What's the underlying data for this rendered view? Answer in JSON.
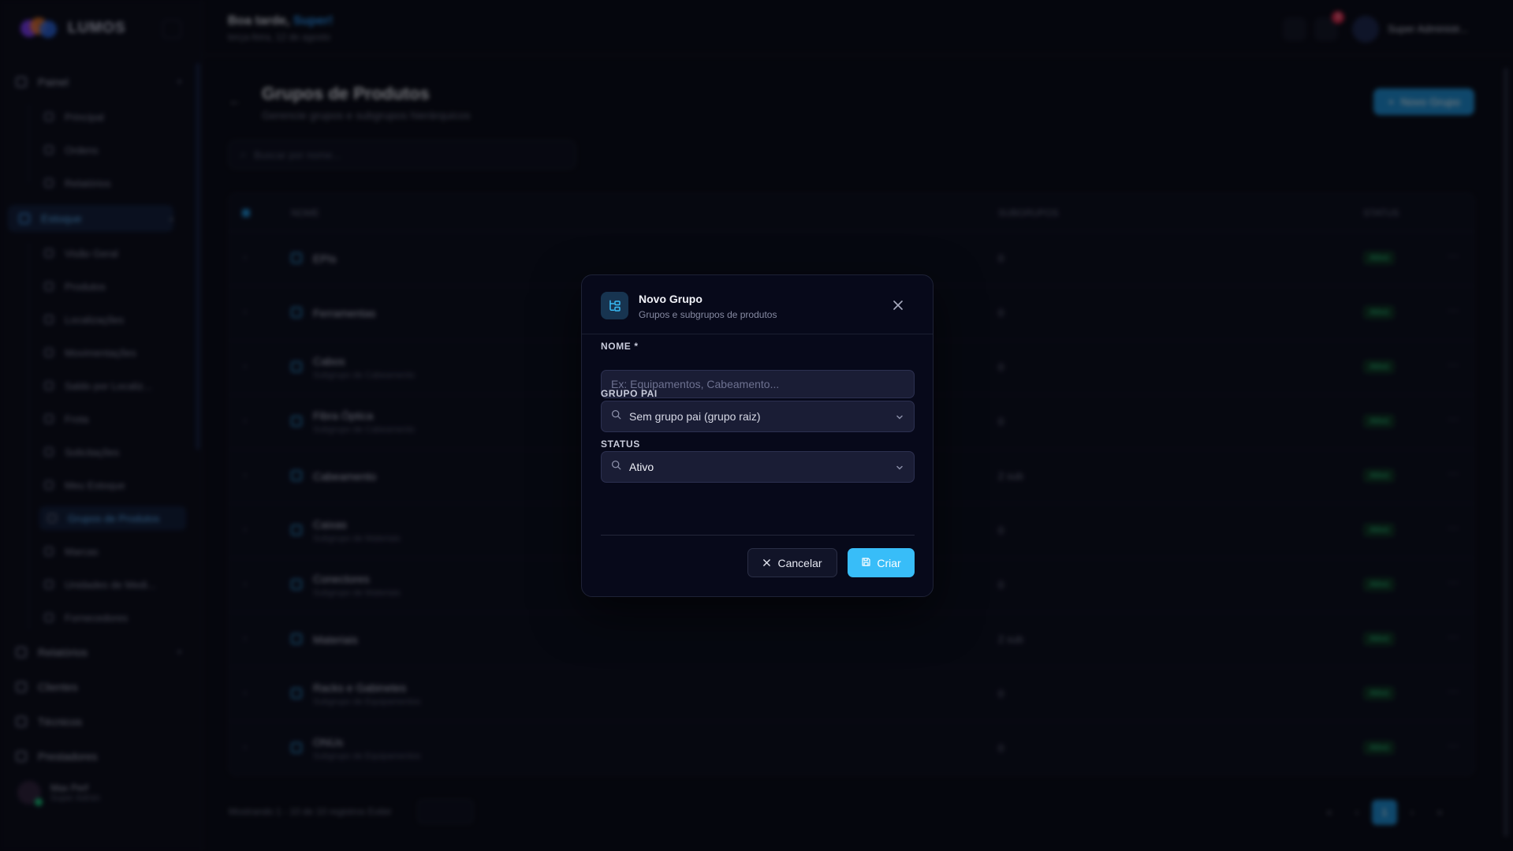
{
  "app": {
    "brand": "LUMOS",
    "greeting_prefix": "Boa tarde,",
    "greeting_name": "Super!",
    "date_line": "terça-feira, 12 de agosto",
    "notifications_count": "3",
    "user_name": "Super Administr..."
  },
  "sidebar": {
    "sections": [
      {
        "label": "Painel",
        "items": [
          "Principal",
          "Ordens",
          "Relatórios"
        ]
      },
      {
        "label": "Estoque",
        "items": [
          "Visão Geral",
          "Produtos",
          "Localizações",
          "Movimentações",
          "Saldo por Localiz...",
          "Frota",
          "Solicitações",
          "Meu Estoque",
          "Grupos de Produtos",
          "Marcas",
          "Unidades de Medi...",
          "Fornecedores"
        ]
      },
      {
        "label": "Relatórios"
      },
      {
        "label": "Clientes"
      },
      {
        "label": "Técnicos"
      },
      {
        "label": "Prestadores"
      }
    ],
    "user": {
      "name": "Max Perf",
      "role": "Super Admin"
    }
  },
  "page": {
    "title": "Grupos de Produtos",
    "subtitle": "Gerencie grupos e subgrupos hierárquicos",
    "new_button": "Novo Grupo",
    "search_placeholder": "Buscar por nome...",
    "columns": {
      "name": "NOME",
      "subgroups": "SUBGRUPOS",
      "status": "STATUS"
    },
    "rows": [
      {
        "name": "EPIs",
        "parent": "",
        "subgroups": "0",
        "status": "Ativo"
      },
      {
        "name": "Ferramentas",
        "parent": "",
        "subgroups": "0",
        "status": "Ativo"
      },
      {
        "name": "Cabos",
        "parent": "Subgrupo de Cabeamento",
        "subgroups": "0",
        "status": "Ativo"
      },
      {
        "name": "Fibra Óptica",
        "parent": "Subgrupo de Cabeamento",
        "subgroups": "0",
        "status": "Ativo"
      },
      {
        "name": "Cabeamento",
        "parent": "",
        "subgroups": "2 sub",
        "status": "Ativo"
      },
      {
        "name": "Caixas",
        "parent": "Subgrupo de Materiais",
        "subgroups": "0",
        "status": "Ativo"
      },
      {
        "name": "Conectores",
        "parent": "Subgrupo de Materiais",
        "subgroups": "0",
        "status": "Ativo"
      },
      {
        "name": "Materiais",
        "parent": "",
        "subgroups": "2 sub",
        "status": "Ativo"
      },
      {
        "name": "Racks e Gabinetes",
        "parent": "Subgrupo de Equipamentos",
        "subgroups": "0",
        "status": "Ativo"
      },
      {
        "name": "ONUs",
        "parent": "Subgrupo de Equipamentos",
        "subgroups": "0",
        "status": "Ativo"
      }
    ],
    "footer_info": "Mostrando 1 - 10 de 10 registros  Exibir",
    "current_page": "1"
  },
  "modal": {
    "title": "Novo Grupo",
    "subtitle": "Grupos e subgrupos de produtos",
    "name_label": "NOME *",
    "name_placeholder": "Ex: Equipamentos, Cabeamento...",
    "name_value": "",
    "parent_label": "GRUPO PAI",
    "parent_value": "Sem grupo pai (grupo raiz)",
    "status_label": "STATUS",
    "status_value": "Ativo",
    "cancel_label": "Cancelar",
    "create_label": "Criar",
    "icons": {
      "header": "folder-tree-icon",
      "close": "close-icon",
      "search": "search-icon",
      "chevron": "chevron-down-icon",
      "cancel": "x-icon",
      "save": "save-icon"
    }
  },
  "colors": {
    "accent": "#38bdf8",
    "background": "#07091a",
    "input_bg": "#1a1d35",
    "status_active": "#2fd98a"
  }
}
